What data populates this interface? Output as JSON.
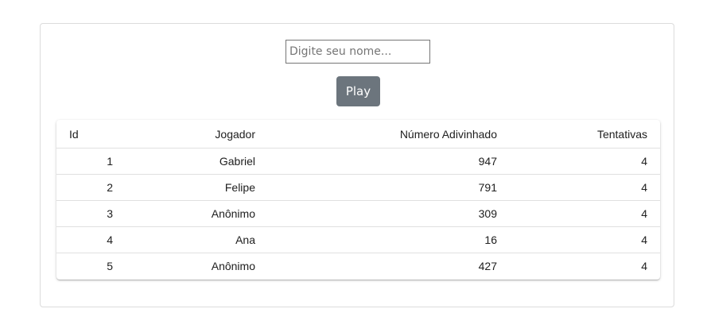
{
  "form": {
    "name_placeholder": "Digite seu nome...",
    "name_value": "",
    "play_label": "Play"
  },
  "table": {
    "headers": [
      "Id",
      "Jogador",
      "Número Adivinhado",
      "Tentativas"
    ],
    "rows": [
      [
        "1",
        "Gabriel",
        "947",
        "4"
      ],
      [
        "2",
        "Felipe",
        "791",
        "4"
      ],
      [
        "3",
        "Anônimo",
        "309",
        "4"
      ],
      [
        "4",
        "Ana",
        "16",
        "4"
      ],
      [
        "5",
        "Anônimo",
        "427",
        "4"
      ]
    ]
  },
  "colors": {
    "button_bg": "#6c757d",
    "button_text": "#ffffff",
    "border": "#dcdcdc",
    "row_divider": "#e0e0e0"
  }
}
